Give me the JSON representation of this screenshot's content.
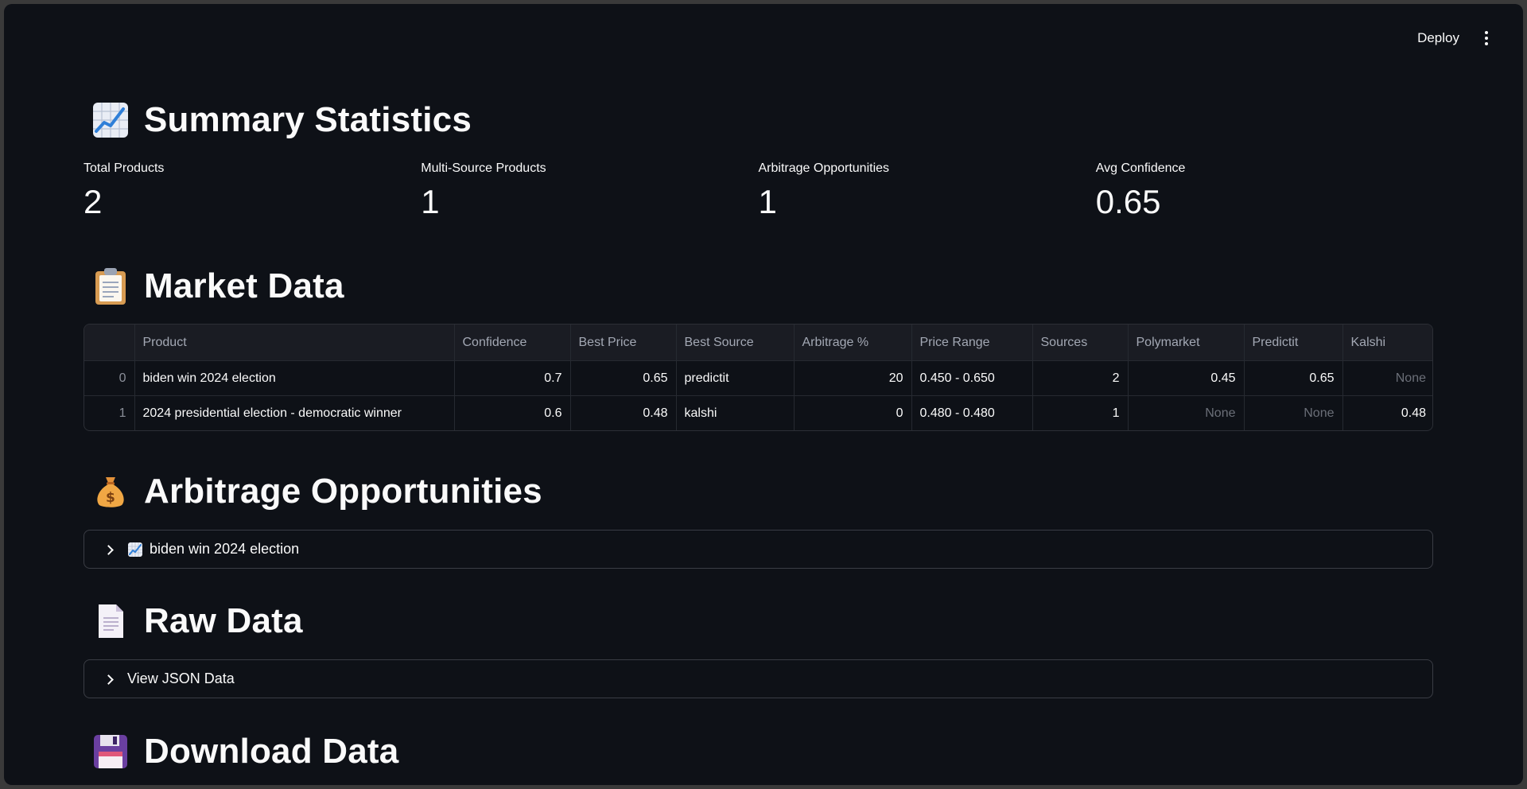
{
  "topbar": {
    "deploy_label": "Deploy"
  },
  "summary": {
    "title": "Summary Statistics",
    "metrics": [
      {
        "label": "Total Products",
        "value": "2"
      },
      {
        "label": "Multi-Source Products",
        "value": "1"
      },
      {
        "label": "Arbitrage Opportunities",
        "value": "1"
      },
      {
        "label": "Avg Confidence",
        "value": "0.65"
      }
    ]
  },
  "market": {
    "title": "Market Data",
    "columns": [
      "",
      "Product",
      "Confidence",
      "Best Price",
      "Best Source",
      "Arbitrage %",
      "Price Range",
      "Sources",
      "Polymarket",
      "Predictit",
      "Kalshi"
    ],
    "rows": [
      [
        "0",
        "biden win 2024 election",
        "0.7",
        "0.65",
        "predictit",
        "20",
        "0.450 - 0.650",
        "2",
        "0.45",
        "0.65",
        "None"
      ],
      [
        "1",
        "2024 presidential election - democratic winner",
        "0.6",
        "0.48",
        "kalshi",
        "0",
        "0.480 - 0.480",
        "1",
        "None",
        "None",
        "0.48"
      ]
    ]
  },
  "arbitrage": {
    "title": "Arbitrage Opportunities",
    "expander_label": "biden win 2024 election"
  },
  "raw": {
    "title": "Raw Data",
    "expander_label": "View JSON Data"
  },
  "download": {
    "title": "Download Data"
  }
}
